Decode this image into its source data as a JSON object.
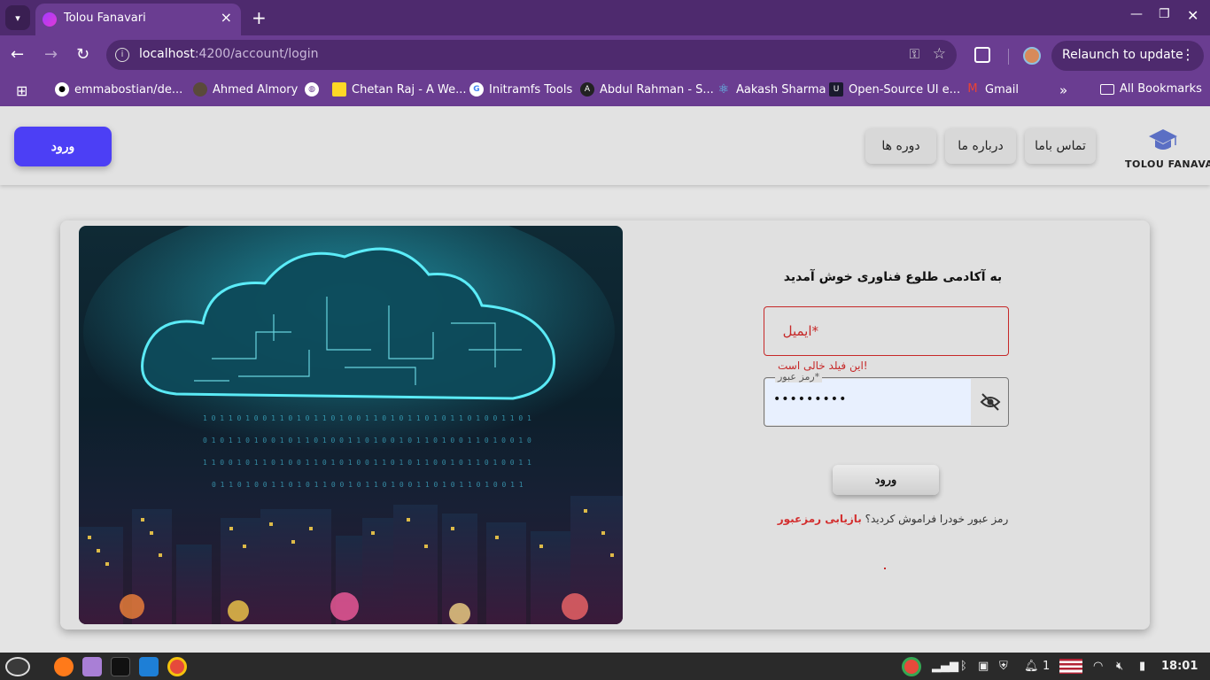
{
  "browser": {
    "tab_title": "Tolou Fanavari",
    "url_host": "localhost",
    "url_path": ":4200/account/login",
    "relaunch_label": "Relaunch to update",
    "bookmarks": [
      {
        "label": "emmabostian/de..."
      },
      {
        "label": "Ahmed Almory"
      },
      {
        "label": ""
      },
      {
        "label": "Chetan Raj - A We..."
      },
      {
        "label": "Initramfs Tools"
      },
      {
        "label": "Abdul Rahman - S..."
      },
      {
        "label": "Aakash Sharma"
      },
      {
        "label": "Open-Source UI e..."
      },
      {
        "label": "Gmail"
      }
    ],
    "all_bookmarks": "All Bookmarks"
  },
  "header": {
    "login_button": "ورود",
    "nav": {
      "contact": "تماس باما",
      "about": "درباره ما",
      "courses": "دوره ها"
    },
    "logo_text": "TOLOU FANAVARI"
  },
  "login": {
    "welcome": "به آکادمی طلوع فناوری خوش آمدید",
    "email_placeholder": "ایمیل*",
    "email_error": "این فیلد خالی است!",
    "password_label": "رمز عبور*",
    "password_value": "•••••••••",
    "submit": "ورود",
    "forgot_text": "رمز عبور خودرا فراموش کردید؟",
    "forgot_link": "بازیابی رمزعبور"
  },
  "taskbar": {
    "clock": "18:01",
    "notification_count": "1"
  },
  "colors": {
    "browser_frame": "#6a3d91",
    "primary_button": "#4c3ff5",
    "error": "#c62828"
  }
}
